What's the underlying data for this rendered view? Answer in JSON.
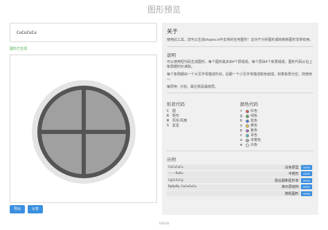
{
  "header": {
    "title": "图形预览"
  },
  "input": {
    "value": "CuCuCuCu"
  },
  "status": {
    "text": "图形已生成"
  },
  "buttons": {
    "export": "导出",
    "share": "分享"
  },
  "panel": {
    "about_title": "关于",
    "about_text": "使用此工具，您可以生成shapez.io中支持的任何图形！这对于分析图形或绘制新图形非常有用。",
    "explain_title": "说明",
    "explain_p1": "可以使用短代码生成图形。每个图形最多由4个层组成，每个层由4个象限组成。图形代码从右上象限顺时针读取。",
    "explain_p2": "每个象限都由一个大写字母描述形状，后跟一个小写字母描述颜色组成。如果象限为空，则使用 --。",
    "explain_p3": "每层用 : 分割，最左侧是最底层。",
    "shape_codes_title": "形状代码",
    "color_codes_title": "颜色代码",
    "shapes": [
      {
        "code": "C",
        "name": "圆"
      },
      {
        "code": "R",
        "name": "矩形"
      },
      {
        "code": "W",
        "name": "风车/风扇"
      },
      {
        "code": "S",
        "name": "星星"
      }
    ],
    "colors": [
      {
        "code": "r",
        "name": "红色",
        "hex": "#e05050"
      },
      {
        "code": "g",
        "name": "绿色",
        "hex": "#4caf50"
      },
      {
        "code": "b",
        "name": "蓝色",
        "hex": "#4a7fd4"
      },
      {
        "code": "y",
        "name": "黄色",
        "hex": "#f0d030"
      },
      {
        "code": "p",
        "name": "紫色",
        "hex": "#b060d0"
      },
      {
        "code": "c",
        "name": "青色",
        "hex": "#40c8c8"
      },
      {
        "code": "u",
        "name": "未着色",
        "hex": "#aaaaaa"
      },
      {
        "code": "w",
        "name": "白色",
        "hex": "#ffffff"
      }
    ],
    "examples_title": "示例",
    "examples": [
      {
        "code": "CuCuCuCu",
        "name": "白色原型",
        "action": "VIEW"
      },
      {
        "code": "----RuRu",
        "name": "半矩形",
        "action": "VIEW"
      },
      {
        "code": "CgScScCg",
        "name": "混合圆和星形状",
        "action": "VIEW"
      },
      {
        "code": "RpRpRp:CwCwCwCw",
        "name": "演示层结构",
        "action": "VIEW"
      },
      {
        "code": "",
        "name": "随机图形",
        "action": "VIEW"
      }
    ]
  },
  "footer": {
    "text": "Github"
  }
}
